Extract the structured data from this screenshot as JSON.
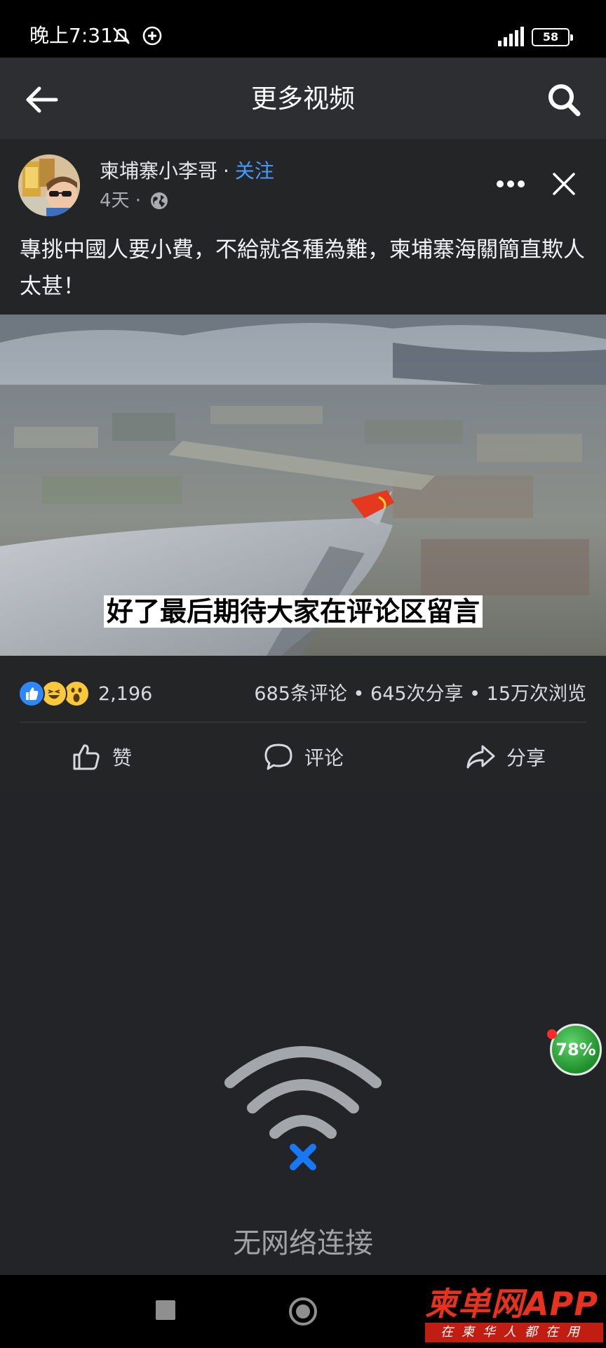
{
  "status_bar": {
    "time": "晚上7:31",
    "battery": "58"
  },
  "header": {
    "title": "更多视频"
  },
  "post": {
    "author": "柬埔寨小李哥",
    "separator": "·",
    "follow_label": "关注",
    "age": "4天 ·",
    "caption": "專挑中國人要小費，不給就各種為難，柬埔寨海關簡直欺人太甚！",
    "video_subtitle": "好了最后期待大家在评论区留言",
    "reaction_count": "2,196",
    "counts": "685条评论 • 645次分享 • 15万次浏览",
    "actions": {
      "like": "赞",
      "comment": "评论",
      "share": "分享"
    }
  },
  "no_network": {
    "message": "无网络连接"
  },
  "floating_badge": "78%",
  "watermark": {
    "title": "柬单网APP",
    "subtitle": "在柬华人都在用"
  },
  "colors": {
    "accent": "#4599ff",
    "background": "#232427",
    "card": "#242527",
    "appbar": "#2d2e31",
    "error_x": "#1877f2"
  }
}
